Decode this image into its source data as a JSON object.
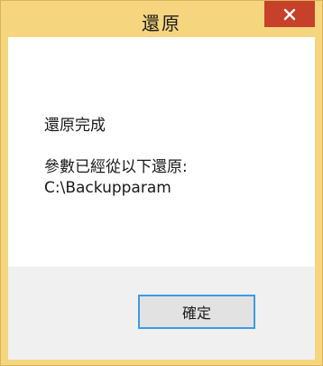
{
  "window": {
    "title": "還原",
    "close_icon": "close-x-icon"
  },
  "message": {
    "line1": "還原完成",
    "line2": "參數已經從以下還原:",
    "line3": "C:\\Backupparam"
  },
  "buttons": {
    "ok_label": "確定"
  },
  "colors": {
    "titlebar": "#f5d67f",
    "close_button": "#c7402a",
    "ok_button_border": "#3c9be6"
  }
}
